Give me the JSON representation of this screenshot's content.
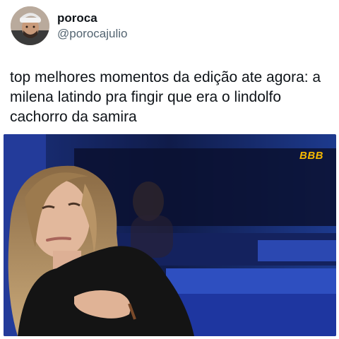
{
  "author": {
    "display_name": "poroca",
    "handle": "@porocajulio"
  },
  "tweet": {
    "text_line1": "top melhores momentos da edição ate agora: a",
    "text_line2": "milena latindo pra fingir que era o lindolfo",
    "text_line3": "cachorro da samira"
  },
  "media": {
    "watermark": "BBB"
  },
  "colors": {
    "name": "#0f1419",
    "handle": "#536471",
    "watermark": "#f5b800",
    "set_blue": "#1e3a8c"
  }
}
